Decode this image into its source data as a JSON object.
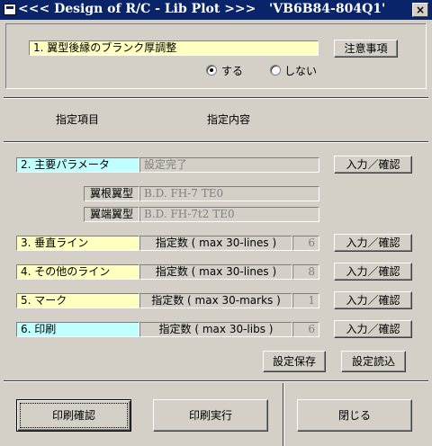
{
  "window": {
    "title": "<<< Design of R/C - Lib Plot >>>   'VB6B84-804Q1'",
    "close_glyph": "×"
  },
  "section1": {
    "label": "1.  翼型後縁のブランク厚調整",
    "notes_button": "注意事項",
    "radio_yes": "する",
    "radio_no": "しない",
    "selected": "する"
  },
  "header": {
    "col1": "指定項目",
    "col2": "指定内容"
  },
  "section2": {
    "label": "2.  主要パラメータ",
    "value": "設定完了",
    "button": "入力／確認",
    "root_label": "翼根翼型",
    "root_value": "B.D. FH-7 TE0",
    "tip_label": "翼端翼型",
    "tip_value": "B.D. FH-7t2 TE0"
  },
  "rows": [
    {
      "label": "3.  垂直ライン",
      "spec": "指定数 ( max 30-lines )",
      "count": "6",
      "button": "入力／確認"
    },
    {
      "label": "4.  その他のライン",
      "spec": "指定数 ( max 30-lines )",
      "count": "8",
      "button": "入力／確認"
    },
    {
      "label": "5.  マーク",
      "spec": "指定数 ( max 30-marks )",
      "count": "1",
      "button": "入力／確認"
    },
    {
      "label": "6.  印刷",
      "spec": "指定数 ( max 30-libs )",
      "count": "6",
      "button": "入力／確認"
    }
  ],
  "settings": {
    "save": "設定保存",
    "load": "設定読込"
  },
  "footer": {
    "print_confirm": "印刷確認",
    "print_run": "印刷実行",
    "close": "閉じる"
  },
  "colors": {
    "title_bg": "#0a246a",
    "yellow_field": "#ffffc0",
    "cyan_field": "#c0ffff",
    "face": "#d4d0c8"
  }
}
